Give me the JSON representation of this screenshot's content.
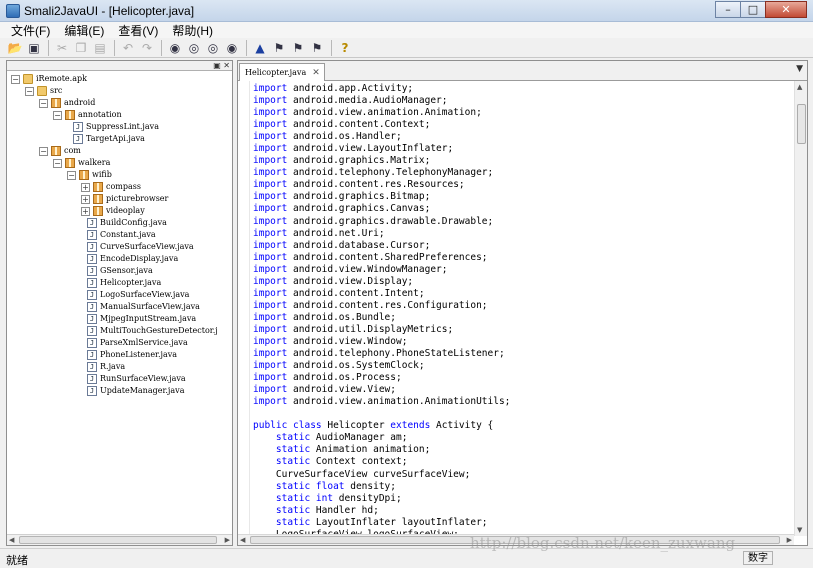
{
  "window": {
    "title": "Smali2JavaUI - [Helicopter.java]",
    "controls": {
      "minimize": "–",
      "maximize": "□",
      "close": "✕"
    }
  },
  "menubar": {
    "items": [
      "文件(F)",
      "编辑(E)",
      "查看(V)",
      "帮助(H)"
    ]
  },
  "toolbar": {
    "icons": [
      "open-folder-icon",
      "save-icon",
      "cut-icon",
      "copy-icon",
      "paste-icon",
      "undo-icon",
      "redo-icon",
      "find-icon",
      "find-next-icon",
      "find-prev-icon",
      "replace-icon",
      "goto-icon",
      "bookmark-icon",
      "bookmark-next-icon",
      "bookmark-clear-icon",
      "help-icon"
    ]
  },
  "project_tree": {
    "header_buttons": "▣ ✕",
    "nodes": [
      {
        "label": "iRemote.apk",
        "type": "folder",
        "depth": 0,
        "expanded": true
      },
      {
        "label": "src",
        "type": "folder",
        "depth": 1,
        "expanded": true
      },
      {
        "label": "android",
        "type": "package",
        "depth": 2,
        "expanded": true
      },
      {
        "label": "annotation",
        "type": "package",
        "depth": 3,
        "expanded": true
      },
      {
        "label": "SuppressLint.java",
        "type": "java",
        "depth": 4
      },
      {
        "label": "TargetApi.java",
        "type": "java",
        "depth": 4
      },
      {
        "label": "com",
        "type": "package",
        "depth": 2,
        "expanded": true
      },
      {
        "label": "walkera",
        "type": "package",
        "depth": 3,
        "expanded": true
      },
      {
        "label": "wifib",
        "type": "package",
        "depth": 4,
        "expanded": true
      },
      {
        "label": "compass",
        "type": "package",
        "depth": 5,
        "expanded": false
      },
      {
        "label": "picturebrowser",
        "type": "package",
        "depth": 5,
        "expanded": false
      },
      {
        "label": "videoplay",
        "type": "package",
        "depth": 5,
        "expanded": false
      },
      {
        "label": "BuildConfig.java",
        "type": "java",
        "depth": 5
      },
      {
        "label": "Constant.java",
        "type": "java",
        "depth": 5
      },
      {
        "label": "CurveSurfaceView.java",
        "type": "java",
        "depth": 5
      },
      {
        "label": "EncodeDisplay.java",
        "type": "java",
        "depth": 5
      },
      {
        "label": "GSensor.java",
        "type": "java",
        "depth": 5
      },
      {
        "label": "Helicopter.java",
        "type": "java",
        "depth": 5
      },
      {
        "label": "LogoSurfaceView.java",
        "type": "java",
        "depth": 5
      },
      {
        "label": "ManualSurfaceView.java",
        "type": "java",
        "depth": 5
      },
      {
        "label": "MjpegInputStream.java",
        "type": "java",
        "depth": 5
      },
      {
        "label": "MultiTouchGestureDetector.j",
        "type": "java",
        "depth": 5
      },
      {
        "label": "ParseXmlService.java",
        "type": "java",
        "depth": 5
      },
      {
        "label": "PhoneListener.java",
        "type": "java",
        "depth": 5
      },
      {
        "label": "R.java",
        "type": "java",
        "depth": 5
      },
      {
        "label": "RunSurfaceView.java",
        "type": "java",
        "depth": 5
      },
      {
        "label": "UpdateManager.java",
        "type": "java",
        "depth": 5
      }
    ]
  },
  "editor": {
    "tab_label": "Helicopter.java",
    "tab_close": "✕",
    "dropdown": "▼",
    "lines": [
      [
        "import",
        " android.app.Activity;"
      ],
      [
        "import",
        " android.media.AudioManager;"
      ],
      [
        "import",
        " android.view.animation.Animation;"
      ],
      [
        "import",
        " android.content.Context;"
      ],
      [
        "import",
        " android.os.Handler;"
      ],
      [
        "import",
        " android.view.LayoutInflater;"
      ],
      [
        "import",
        " android.graphics.Matrix;"
      ],
      [
        "import",
        " android.telephony.TelephonyManager;"
      ],
      [
        "import",
        " android.content.res.Resources;"
      ],
      [
        "import",
        " android.graphics.Bitmap;"
      ],
      [
        "import",
        " android.graphics.Canvas;"
      ],
      [
        "import",
        " android.graphics.drawable.Drawable;"
      ],
      [
        "import",
        " android.net.Uri;"
      ],
      [
        "import",
        " android.database.Cursor;"
      ],
      [
        "import",
        " android.content.SharedPreferences;"
      ],
      [
        "import",
        " android.view.WindowManager;"
      ],
      [
        "import",
        " android.view.Display;"
      ],
      [
        "import",
        " android.content.Intent;"
      ],
      [
        "import",
        " android.content.res.Configuration;"
      ],
      [
        "import",
        " android.os.Bundle;"
      ],
      [
        "import",
        " android.util.DisplayMetrics;"
      ],
      [
        "import",
        " android.view.Window;"
      ],
      [
        "import",
        " android.telephony.PhoneStateListener;"
      ],
      [
        "import",
        " android.os.SystemClock;"
      ],
      [
        "import",
        " android.os.Process;"
      ],
      [
        "import",
        " android.view.View;"
      ],
      [
        "import",
        " android.view.animation.AnimationUtils;"
      ],
      [
        "",
        ""
      ],
      [
        "public class",
        " Helicopter ",
        "extends",
        " Activity {"
      ],
      [
        "    static",
        " AudioManager am;"
      ],
      [
        "    static",
        " Animation animation;"
      ],
      [
        "    static",
        " Context context;"
      ],
      [
        "",
        "    CurveSurfaceView curveSurfaceView;"
      ],
      [
        "    static float",
        " density;"
      ],
      [
        "    static int",
        " densityDpi;"
      ],
      [
        "    static",
        " Handler hd;"
      ],
      [
        "    static",
        " LayoutInflater layoutInflater;"
      ],
      [
        "",
        "    LogoSurfaceView logoSurfaceView;"
      ]
    ]
  },
  "statusbar": {
    "text": "就绪",
    "mode": "数字"
  },
  "watermark": "http://blog.csdn.net/keen_zuxwang"
}
